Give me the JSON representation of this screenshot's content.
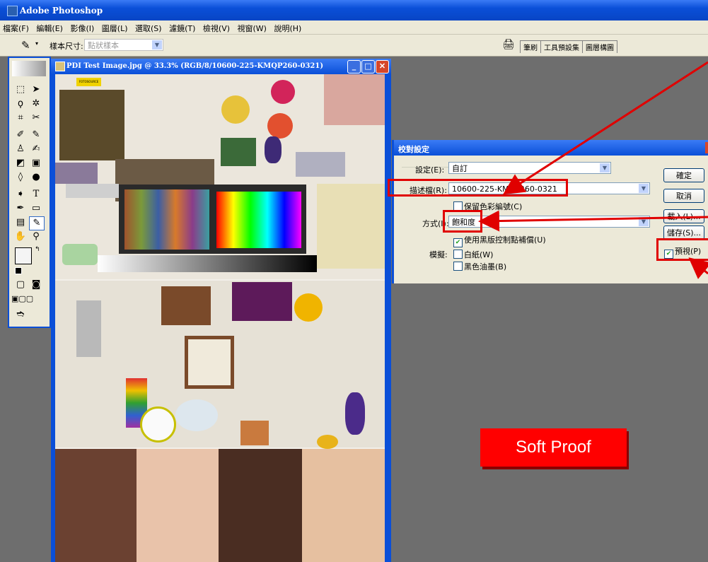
{
  "app": {
    "title": "Adobe Photoshop"
  },
  "menu": [
    "檔案(F)",
    "編輯(E)",
    "影像(I)",
    "圖層(L)",
    "選取(S)",
    "濾鏡(T)",
    "檢視(V)",
    "視窗(W)",
    "說明(H)"
  ],
  "options": {
    "sample_label": "樣本尺寸:",
    "sample_value": "點狀樣本"
  },
  "palette_tabs": [
    "筆刷",
    "工具預設集",
    "圖層構圖"
  ],
  "document": {
    "title": "PDI Test Image.jpg @ 33.3% (RGB/8/10600-225-KMQP260-0321)",
    "logo": "FOTOSOURCE"
  },
  "dialog": {
    "title": "校對設定",
    "setup_label": "設定(E):",
    "setup_value": "自訂",
    "profile_label": "描述檔(R):",
    "profile_value": "10600-225-KMQP260-0321",
    "preserve_label": "保留色彩編號(C)",
    "intent_label": "方式(I):",
    "intent_value": "飽和度",
    "bpc_label": "使用黑版控制點補償(U)",
    "simulate_label": "模擬:",
    "paper_white_label": "白紙(W)",
    "ink_black_label": "黑色油墨(B)",
    "ok_label": "確定",
    "cancel_label": "取消",
    "load_label": "載入(L)...",
    "save_label": "儲存(S)...",
    "preview_label": "預視(P)"
  },
  "annotation": {
    "soft_proof": "Soft Proof"
  },
  "colors": {
    "accent": "#0a4fd8",
    "highlight": "#e00000",
    "label_bg": "#ff0000"
  }
}
